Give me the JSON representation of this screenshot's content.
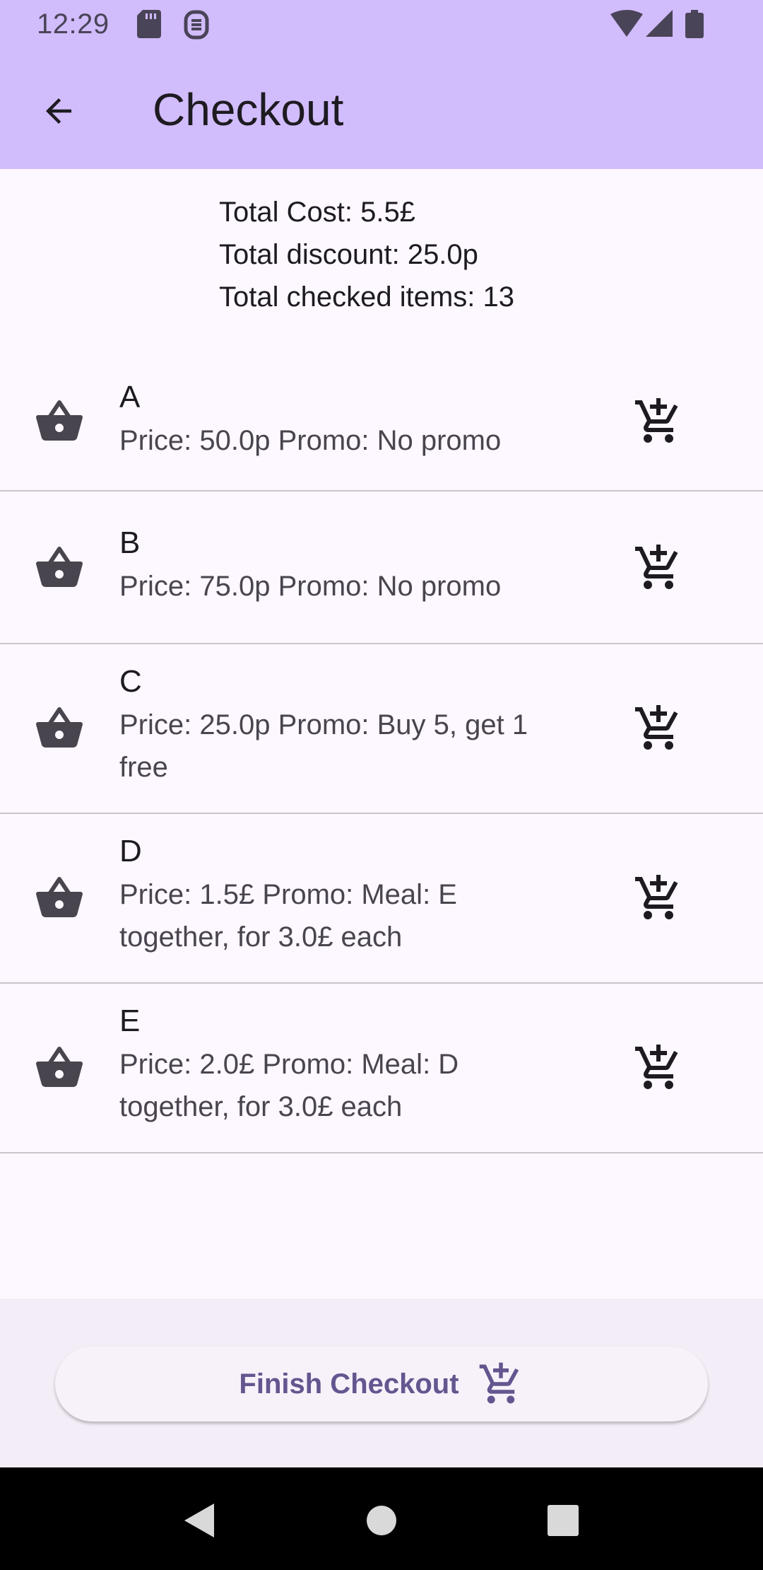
{
  "status_bar": {
    "time": "12:29",
    "icons": [
      "sd-card-icon",
      "sim-icon",
      "wifi-icon",
      "signal-icon",
      "battery-icon"
    ]
  },
  "app_bar": {
    "title": "Checkout",
    "back_icon": "arrow-back-icon"
  },
  "summary": {
    "total_cost": "Total Cost: 5.5£",
    "total_discount": "Total discount: 25.0p",
    "total_checked": "Total checked items: 13"
  },
  "items": [
    {
      "name": "A",
      "details": "Price: 50.0p Promo: No promo"
    },
    {
      "name": "B",
      "details": "Price: 75.0p Promo: No promo"
    },
    {
      "name": "C",
      "details": "Price: 25.0p Promo: Buy 5, get 1 free"
    },
    {
      "name": "D",
      "details": "Price: 1.5£ Promo: Meal: E together, for 3.0£ each"
    },
    {
      "name": "E",
      "details": "Price: 2.0£ Promo: Meal: D together, for 3.0£ each"
    }
  ],
  "finish": {
    "label": "Finish Checkout",
    "icon": "add-shopping-cart-icon"
  },
  "colors": {
    "app_bar": "#d1bcfc",
    "background": "#fdf7ff",
    "bottom_panel": "#f3edf7",
    "accent": "#65558f"
  }
}
